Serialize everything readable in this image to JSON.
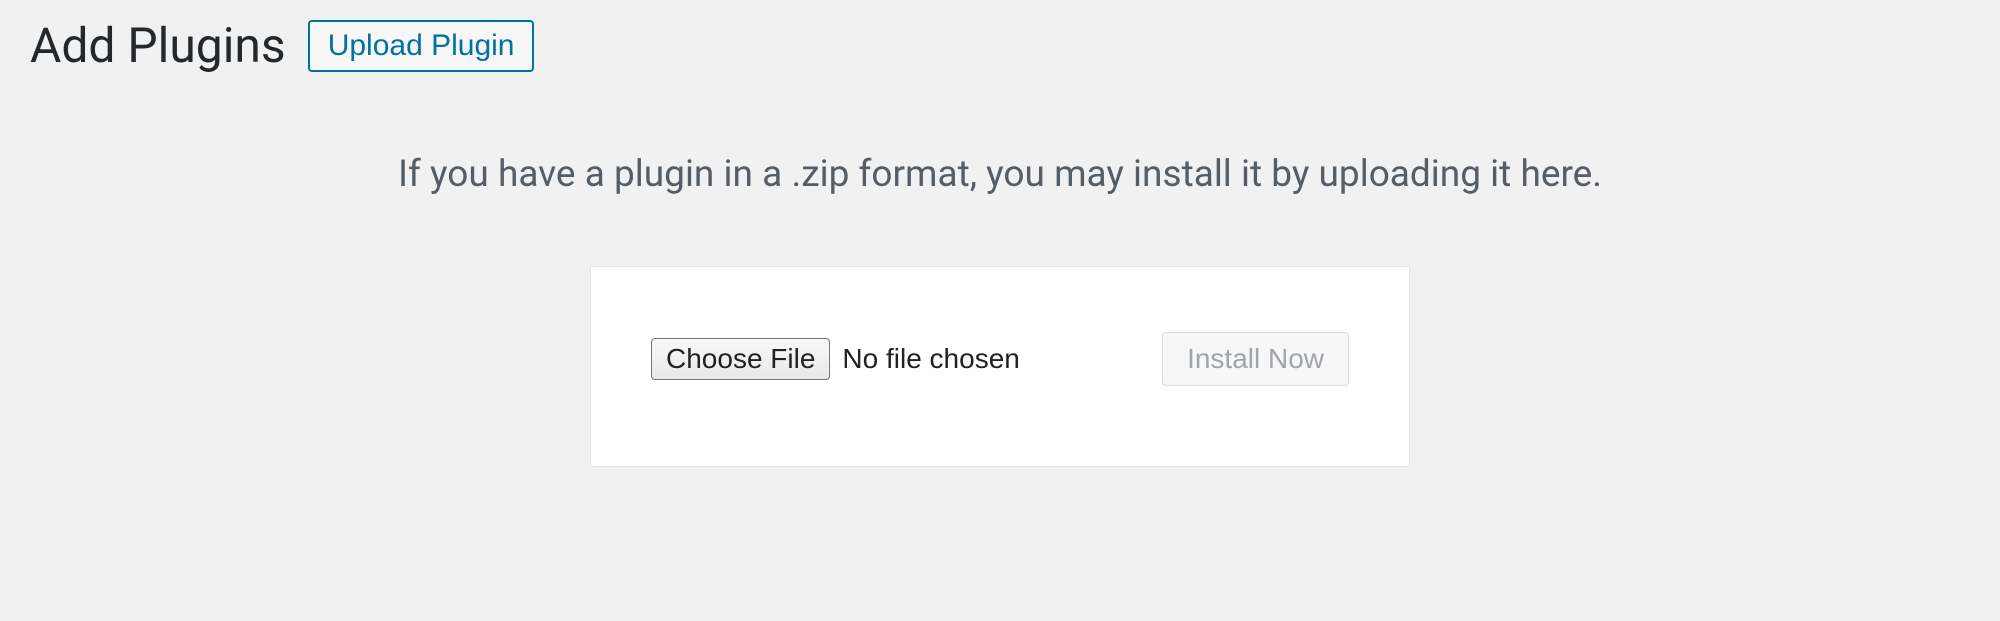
{
  "header": {
    "title": "Add Plugins",
    "upload_button": "Upload Plugin"
  },
  "upload": {
    "description": "If you have a plugin in a .zip format, you may install it by uploading it here.",
    "choose_file_label": "Choose File",
    "file_status": "No file chosen",
    "install_button": "Install Now"
  }
}
